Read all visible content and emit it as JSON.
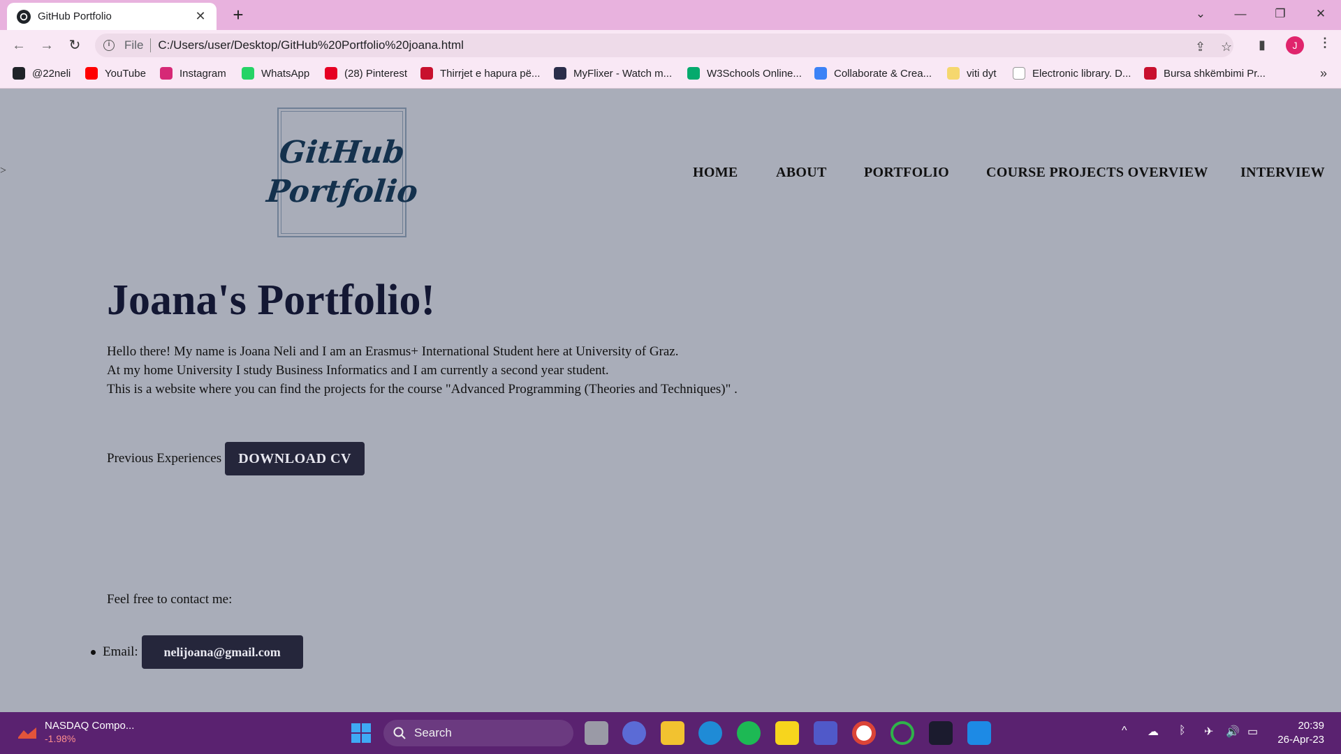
{
  "browser": {
    "tab_title": "GitHub Portfolio",
    "tab_close": "✕",
    "new_tab": "+",
    "address_scheme": "File",
    "address_url": "C:/Users/user/Desktop/GitHub%20Portfolio%20joana.html",
    "profile_initial": "J",
    "bookmarks": [
      {
        "label": "@22neli",
        "icon": "github-icon",
        "color": "#1f2328"
      },
      {
        "label": "YouTube",
        "icon": "youtube-icon",
        "color": "#ff0000"
      },
      {
        "label": "Instagram",
        "icon": "instagram-icon",
        "color": "#d62976"
      },
      {
        "label": "WhatsApp",
        "icon": "whatsapp-icon",
        "color": "#25d366"
      },
      {
        "label": "(28) Pinterest",
        "icon": "pinterest-icon",
        "color": "#e60023"
      },
      {
        "label": "Thirrjet e hapura pë...",
        "icon": "eagle-icon",
        "color": "#c8102e"
      },
      {
        "label": "MyFlixer - Watch m...",
        "icon": "film-icon",
        "color": "#2a2d4a"
      },
      {
        "label": "W3Schools Online...",
        "icon": "w3schools-icon",
        "color": "#04aa6d"
      },
      {
        "label": "Collaborate & Crea...",
        "icon": "canva-icon",
        "color": "#3b82f6"
      },
      {
        "label": "viti dyt",
        "icon": "folder-icon",
        "color": "#f5d76e"
      },
      {
        "label": "Electronic library. D...",
        "icon": "library-icon",
        "color": "#ffffff"
      },
      {
        "label": "Bursa shkëmbimi Pr...",
        "icon": "eagle-icon",
        "color": "#c8102e"
      }
    ],
    "bookmarks_more": "»"
  },
  "site": {
    "logo_line1": "GitHub",
    "logo_line2": "Portfolio",
    "side_arrow": ">",
    "nav": [
      "HOME",
      "ABOUT",
      "PORTFOLIO",
      "COURSE PROJECTS OVERVIEW",
      "INTERVIEW"
    ],
    "title": "Joana's Portfolio!",
    "intro": [
      "Hello there! My name is Joana Neli and I am an Erasmus+ International Student here at University of Graz.",
      "At my home University I study Business Informatics and I am currently a second year student.",
      "This is a website where you can find the projects for the course \"Advanced Programming (Theories and Techniques)\" ."
    ],
    "prev_label": "Previous Experiences",
    "cv_button": "DOWNLOAD CV",
    "contact_label": "Feel free to contact me:",
    "email_label": "Email:",
    "email_button": "nelijoana@gmail.com"
  },
  "taskbar": {
    "widget_title": "NASDAQ Compo...",
    "widget_change": "-1.98%",
    "search_label": "Search",
    "time": "20:39",
    "date": "26-Apr-23"
  }
}
